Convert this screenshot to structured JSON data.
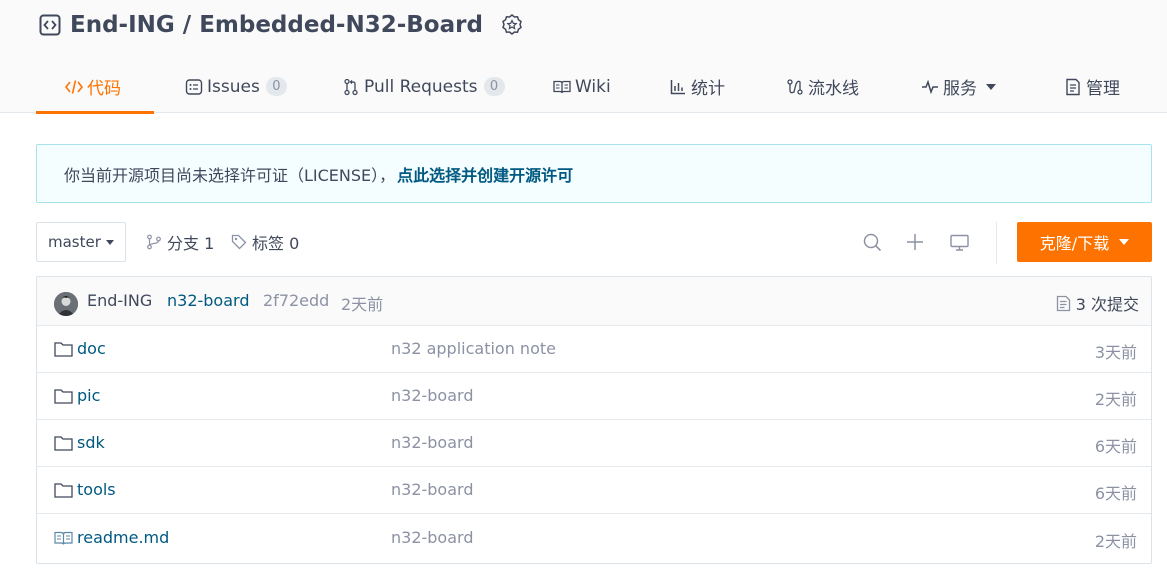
{
  "repo": {
    "title": "End-ING / Embedded-N32-Board",
    "icon": "repo-code-icon",
    "badge_icon": "recommended-badge-icon"
  },
  "tabs": [
    {
      "label": "代码",
      "icon": "code-icon",
      "active": true
    },
    {
      "label": "Issues",
      "icon": "issues-icon",
      "count": "0"
    },
    {
      "label": "Pull Requests",
      "icon": "pull-request-icon",
      "count": "0"
    },
    {
      "label": "Wiki",
      "icon": "wiki-book-icon"
    },
    {
      "label": "统计",
      "icon": "bar-chart-icon"
    },
    {
      "label": "流水线",
      "icon": "pipeline-icon"
    },
    {
      "label": "服务",
      "icon": "pulse-icon"
    },
    {
      "label": "管理",
      "icon": "manage-icon"
    }
  ],
  "notice": {
    "text": "你当前开源项目尚未选择许可证（LICENSE），",
    "link": "点此选择并创建开源许可"
  },
  "toolbar": {
    "branch": "master",
    "branches_label": "分支 1",
    "tags_label": "标签 0",
    "clone_label": "克隆/下载"
  },
  "commit": {
    "author": "End-ING",
    "message": "n32-board",
    "sha": "2f72edd",
    "time": "2天前",
    "count_label": "3 次提交"
  },
  "files": [
    {
      "name": "doc",
      "type": "folder",
      "commit": "n32 application note",
      "time": "3天前"
    },
    {
      "name": "pic",
      "type": "folder",
      "commit": "n32-board",
      "time": "2天前"
    },
    {
      "name": "sdk",
      "type": "folder",
      "commit": "n32-board",
      "time": "6天前"
    },
    {
      "name": "tools",
      "type": "folder",
      "commit": "n32-board",
      "time": "6天前"
    },
    {
      "name": "readme.md",
      "type": "file",
      "commit": "n32-board",
      "time": "2天前"
    }
  ],
  "colors": {
    "accent": "#fe7300",
    "link": "#005980",
    "muted": "#8c92a4",
    "text": "#40485b",
    "notice_border": "#a8e3eb",
    "notice_bg": "#f4fdff"
  }
}
